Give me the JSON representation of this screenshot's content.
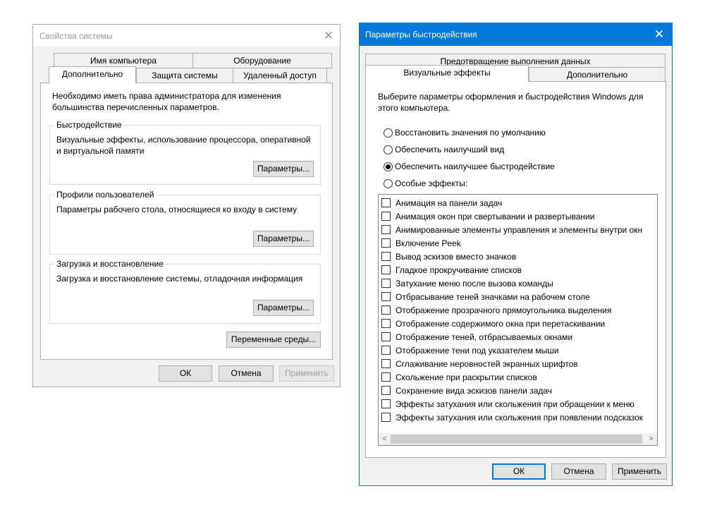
{
  "system_properties": {
    "title": "Свойства системы",
    "close_glyph": "✕",
    "tabs_row1": [
      "Имя компьютера",
      "Оборудование"
    ],
    "tabs_row2": [
      "Дополнительно",
      "Защита системы",
      "Удаленный доступ"
    ],
    "admin_note": "Необходимо иметь права администратора для изменения большинства перечисленных параметров.",
    "performance": {
      "label": "Быстродействие",
      "description": "Визуальные эффекты, использование процессора, оперативной и виртуальной памяти",
      "button": "Параметры..."
    },
    "user_profiles": {
      "label": "Профили пользователей",
      "description": "Параметры рабочего стола, относящиеся ко входу в систему",
      "button": "Параметры..."
    },
    "startup_recovery": {
      "label": "Загрузка и восстановление",
      "description": "Загрузка и восстановление системы, отладочная информация",
      "button": "Параметры..."
    },
    "env_vars_button": "Переменные среды...",
    "ok": "ОК",
    "cancel": "Отмена",
    "apply": "Применить"
  },
  "performance_options": {
    "title": "Параметры быстродействия",
    "close_glyph": "✕",
    "tab_top": "Предотвращение выполнения данных",
    "tabs_bottom": [
      "Визуальные эффекты",
      "Дополнительно"
    ],
    "description": "Выберите параметры оформления и быстродействия Windows для этого компьютера.",
    "radios": [
      {
        "label": "Восстановить значения по умолчанию",
        "checked": false
      },
      {
        "label": "Обеспечить наилучший вид",
        "checked": false
      },
      {
        "label": "Обеспечить наилучшее быстродействие",
        "checked": true
      },
      {
        "label": "Особые эффекты:",
        "checked": false
      }
    ],
    "effects": [
      "Анимация на панели задач",
      "Анимация окон при свертывании и развертывании",
      "Анимированные элементы управления и элементы внутри окн",
      "Включение Peek",
      "Вывод эскизов вместо значков",
      "Гладкое прокручивание списков",
      "Затухание меню после вызова команды",
      "Отбрасывание теней значками на рабочем столе",
      "Отображение прозрачного прямоугольника выделения",
      "Отображение содержимого окна при перетаскивании",
      "Отображение теней, отбрасываемых окнами",
      "Отображение тени под указателем мыши",
      "Сглаживание неровностей экранных шрифтов",
      "Скольжение при раскрытии списков",
      "Сохранение вида эскизов панели задач",
      "Эффекты затухания или скольжения при обращении к меню",
      "Эффекты затухания или скольжения при появлении подсказок"
    ],
    "scroll_left": "<",
    "scroll_right": ">",
    "ok": "ОК",
    "cancel": "Отмена",
    "apply": "Применить"
  }
}
